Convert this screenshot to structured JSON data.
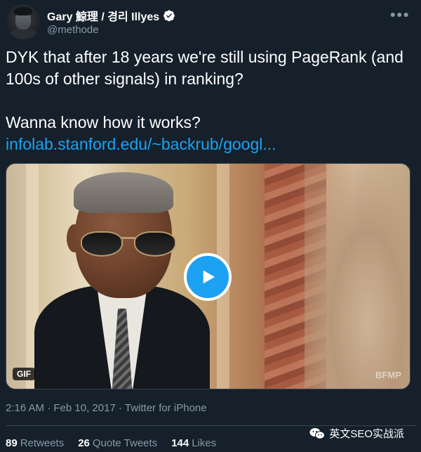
{
  "author": {
    "display_name": "Gary 鯨理 / 경리 Illyes",
    "handle": "@methode",
    "verified": true
  },
  "tweet": {
    "line1": "DYK that after 18 years we're still using PageRank (and 100s of other signals) in ranking?",
    "line2": "Wanna know how it works?",
    "link": "infolab.stanford.edu/~backrub/googl..."
  },
  "media": {
    "badge": "GIF",
    "watermark": "BFMP"
  },
  "meta": {
    "time": "2:16 AM",
    "date": "Feb 10, 2017",
    "separator": "·",
    "source": "Twitter for iPhone"
  },
  "stats": {
    "retweets_count": "89",
    "retweets_label": "Retweets",
    "quotes_count": "26",
    "quotes_label": "Quote Tweets",
    "likes_count": "144",
    "likes_label": "Likes"
  },
  "wechat_label": "英文SEO实战派",
  "colors": {
    "background": "#15202b",
    "accent": "#1da1f2",
    "muted": "#8899a6"
  }
}
